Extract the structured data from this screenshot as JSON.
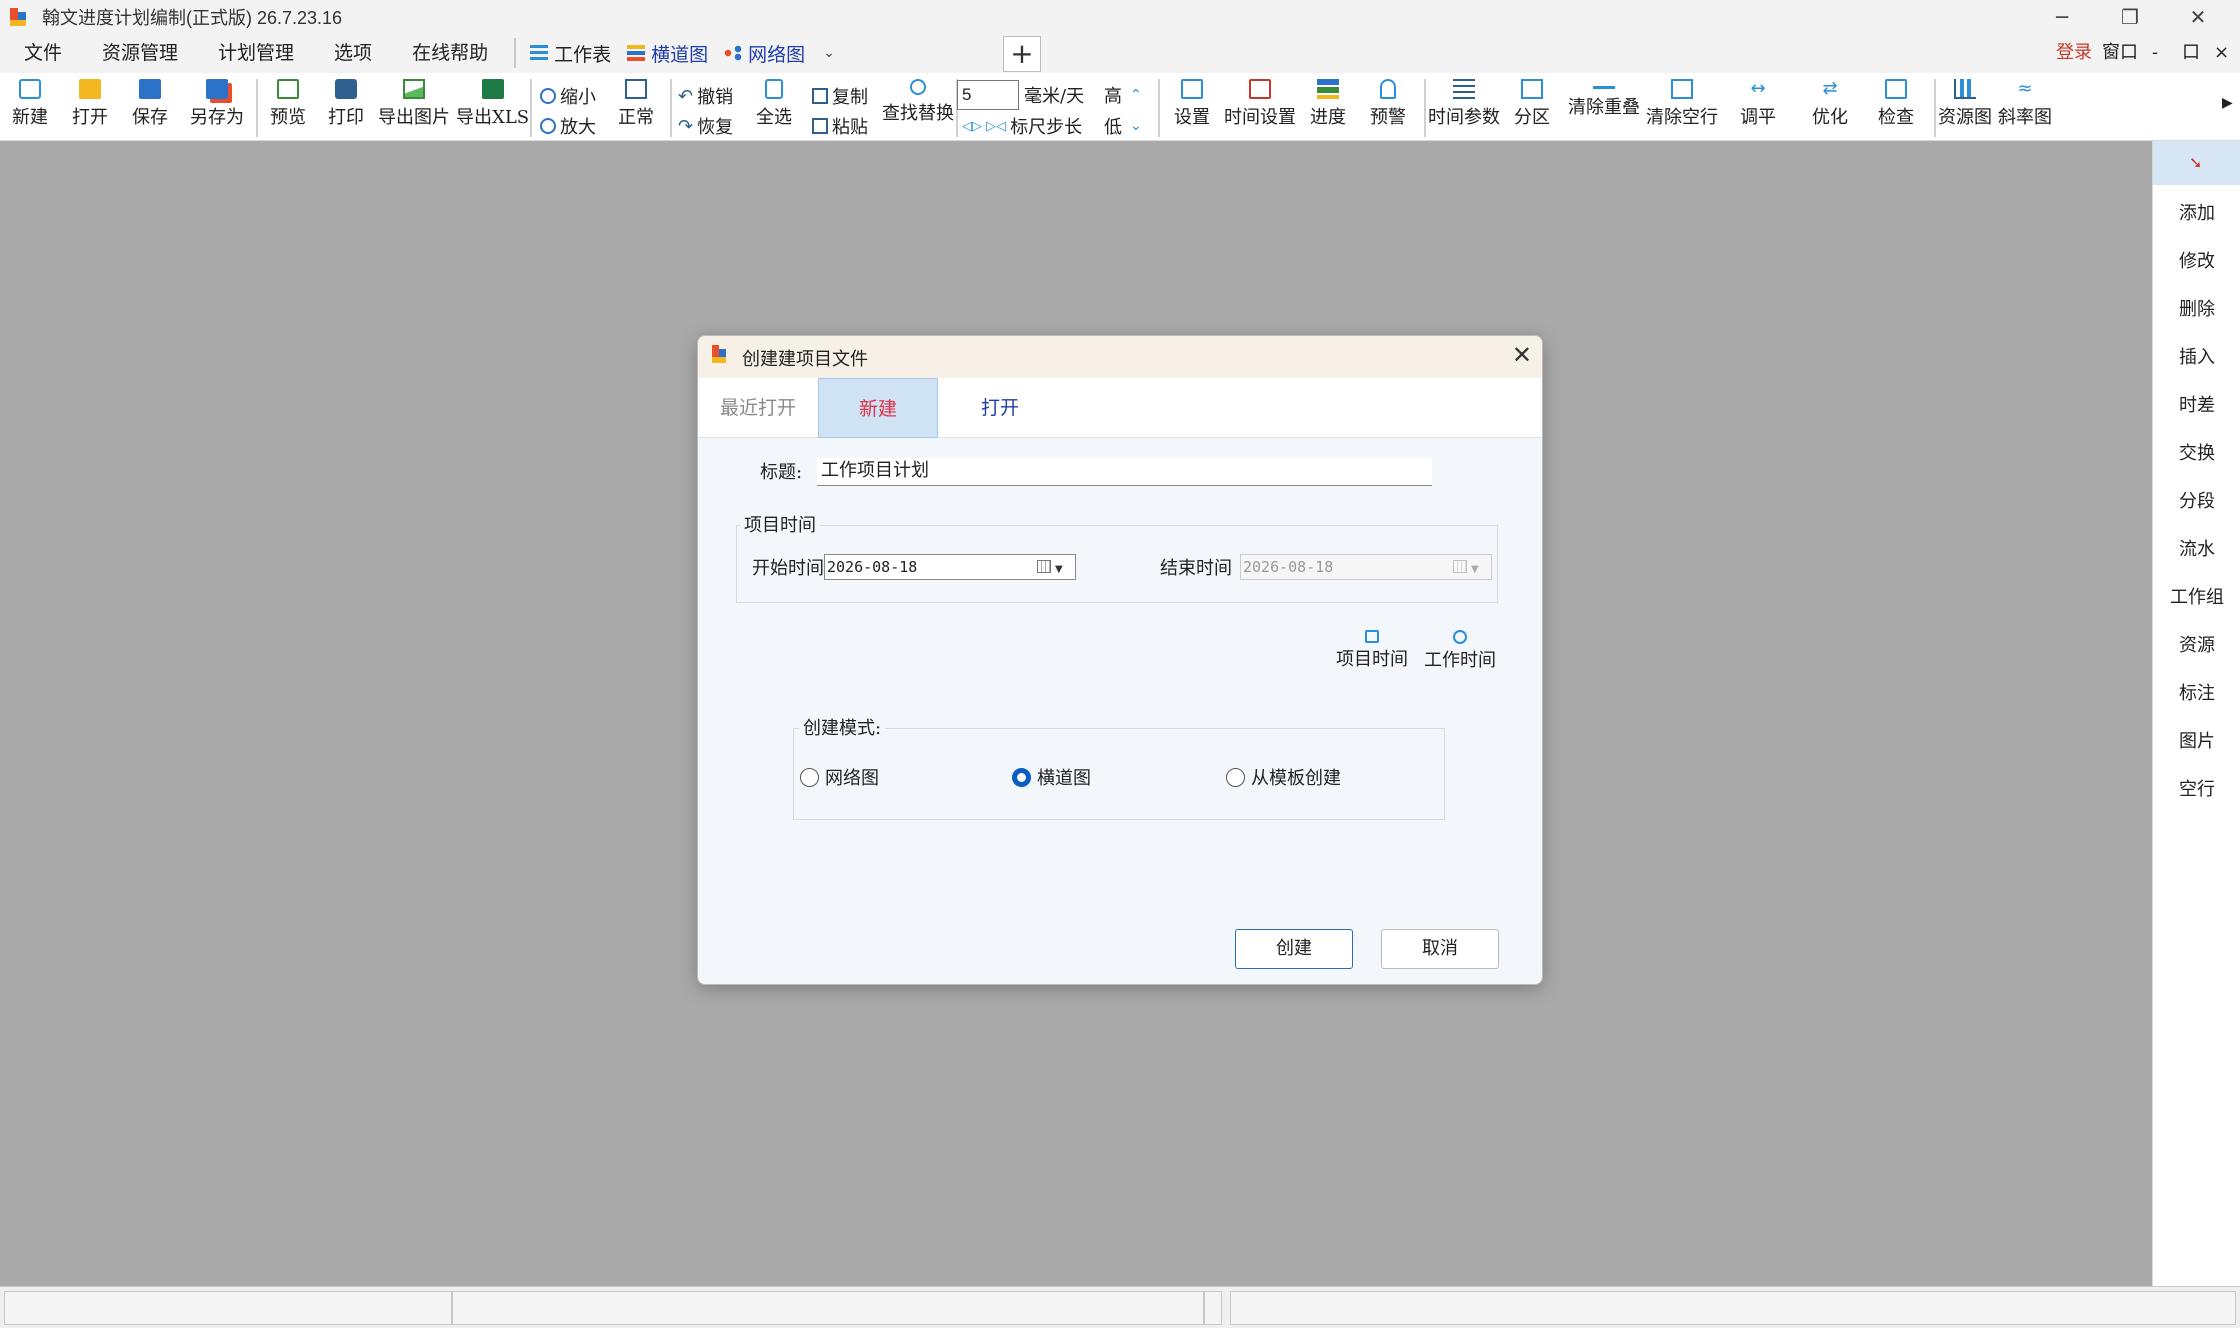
{
  "window": {
    "title": "翰文进度计划编制(正式版) 26.7.23.16",
    "controls": [
      "─",
      "❐",
      "✕"
    ]
  },
  "menu": {
    "items": [
      "文件",
      "资源管理",
      "计划管理",
      "选项",
      "在线帮助"
    ],
    "views": [
      "工作表",
      "横道图",
      "网络图"
    ],
    "plus": "+",
    "right": [
      "登录",
      "窗口",
      "-",
      "口",
      "×"
    ]
  },
  "toolbar": {
    "file": [
      "新建",
      "打开",
      "保存",
      "另存为"
    ],
    "print": [
      "预览",
      "打印",
      "导出图片",
      "导出XLS"
    ],
    "zoom_out": "缩小",
    "zoom_in": "放大",
    "normal": "正常",
    "undo": "撤销",
    "redo": "恢复",
    "select_all": "全选",
    "copy": "复制",
    "paste": "粘贴",
    "find_replace": "查找替换",
    "scale_value": "5",
    "scale_unit": "毫米/天",
    "high": "高",
    "low": "低",
    "ruler_step": "标尺步长",
    "tools": [
      "设置",
      "时间设置",
      "进度",
      "预警"
    ],
    "tools2": [
      "时间参数",
      "分区",
      "清除重叠",
      "清除空行",
      "调平",
      "优化",
      "检查"
    ],
    "charts": [
      "资源图",
      "斜率图"
    ]
  },
  "sidepanel": {
    "items": [
      "添加",
      "修改",
      "删除",
      "插入",
      "时差",
      "交换",
      "分段",
      "流水",
      "工作组",
      "资源",
      "标注",
      "图片",
      "空行"
    ]
  },
  "dialog": {
    "title": "创建建项目文件",
    "close": "✕",
    "tabs": [
      "最近打开",
      "新建",
      "打开"
    ],
    "title_label": "标题:",
    "title_value": "工作项目计划",
    "project_time_group": "项目时间",
    "start_label": "开始时间",
    "start_value": "2026-08-18",
    "end_label": "结束时间",
    "end_value": "2026-08-18",
    "link_project_time": "项目时间",
    "link_work_time": "工作时间",
    "mode_group": "创建模式:",
    "mode_options": [
      "网络图",
      "横道图",
      "从模板创建"
    ],
    "mode_selected": "横道图",
    "create_button": "创建",
    "cancel_button": "取消"
  },
  "colors": {
    "accent": "#0a5dc2",
    "active_tab_text": "#e0324a",
    "link_text": "#1f3fa8",
    "login_text": "#c0392b"
  }
}
